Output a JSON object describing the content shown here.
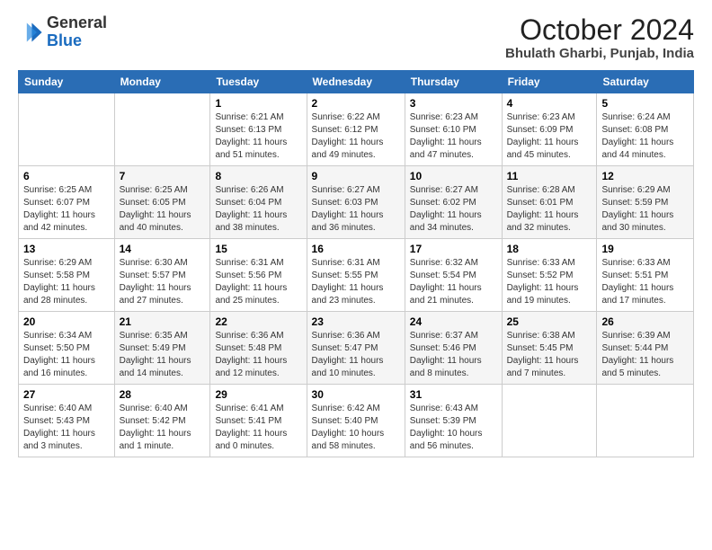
{
  "header": {
    "logo": {
      "general": "General",
      "blue": "Blue"
    },
    "title": "October 2024",
    "subtitle": "Bhulath Gharbi, Punjab, India"
  },
  "weekdays": [
    "Sunday",
    "Monday",
    "Tuesday",
    "Wednesday",
    "Thursday",
    "Friday",
    "Saturday"
  ],
  "weeks": [
    [
      {
        "day": "",
        "info": ""
      },
      {
        "day": "",
        "info": ""
      },
      {
        "day": "1",
        "info": "Sunrise: 6:21 AM\nSunset: 6:13 PM\nDaylight: 11 hours\nand 51 minutes."
      },
      {
        "day": "2",
        "info": "Sunrise: 6:22 AM\nSunset: 6:12 PM\nDaylight: 11 hours\nand 49 minutes."
      },
      {
        "day": "3",
        "info": "Sunrise: 6:23 AM\nSunset: 6:10 PM\nDaylight: 11 hours\nand 47 minutes."
      },
      {
        "day": "4",
        "info": "Sunrise: 6:23 AM\nSunset: 6:09 PM\nDaylight: 11 hours\nand 45 minutes."
      },
      {
        "day": "5",
        "info": "Sunrise: 6:24 AM\nSunset: 6:08 PM\nDaylight: 11 hours\nand 44 minutes."
      }
    ],
    [
      {
        "day": "6",
        "info": "Sunrise: 6:25 AM\nSunset: 6:07 PM\nDaylight: 11 hours\nand 42 minutes."
      },
      {
        "day": "7",
        "info": "Sunrise: 6:25 AM\nSunset: 6:05 PM\nDaylight: 11 hours\nand 40 minutes."
      },
      {
        "day": "8",
        "info": "Sunrise: 6:26 AM\nSunset: 6:04 PM\nDaylight: 11 hours\nand 38 minutes."
      },
      {
        "day": "9",
        "info": "Sunrise: 6:27 AM\nSunset: 6:03 PM\nDaylight: 11 hours\nand 36 minutes."
      },
      {
        "day": "10",
        "info": "Sunrise: 6:27 AM\nSunset: 6:02 PM\nDaylight: 11 hours\nand 34 minutes."
      },
      {
        "day": "11",
        "info": "Sunrise: 6:28 AM\nSunset: 6:01 PM\nDaylight: 11 hours\nand 32 minutes."
      },
      {
        "day": "12",
        "info": "Sunrise: 6:29 AM\nSunset: 5:59 PM\nDaylight: 11 hours\nand 30 minutes."
      }
    ],
    [
      {
        "day": "13",
        "info": "Sunrise: 6:29 AM\nSunset: 5:58 PM\nDaylight: 11 hours\nand 28 minutes."
      },
      {
        "day": "14",
        "info": "Sunrise: 6:30 AM\nSunset: 5:57 PM\nDaylight: 11 hours\nand 27 minutes."
      },
      {
        "day": "15",
        "info": "Sunrise: 6:31 AM\nSunset: 5:56 PM\nDaylight: 11 hours\nand 25 minutes."
      },
      {
        "day": "16",
        "info": "Sunrise: 6:31 AM\nSunset: 5:55 PM\nDaylight: 11 hours\nand 23 minutes."
      },
      {
        "day": "17",
        "info": "Sunrise: 6:32 AM\nSunset: 5:54 PM\nDaylight: 11 hours\nand 21 minutes."
      },
      {
        "day": "18",
        "info": "Sunrise: 6:33 AM\nSunset: 5:52 PM\nDaylight: 11 hours\nand 19 minutes."
      },
      {
        "day": "19",
        "info": "Sunrise: 6:33 AM\nSunset: 5:51 PM\nDaylight: 11 hours\nand 17 minutes."
      }
    ],
    [
      {
        "day": "20",
        "info": "Sunrise: 6:34 AM\nSunset: 5:50 PM\nDaylight: 11 hours\nand 16 minutes."
      },
      {
        "day": "21",
        "info": "Sunrise: 6:35 AM\nSunset: 5:49 PM\nDaylight: 11 hours\nand 14 minutes."
      },
      {
        "day": "22",
        "info": "Sunrise: 6:36 AM\nSunset: 5:48 PM\nDaylight: 11 hours\nand 12 minutes."
      },
      {
        "day": "23",
        "info": "Sunrise: 6:36 AM\nSunset: 5:47 PM\nDaylight: 11 hours\nand 10 minutes."
      },
      {
        "day": "24",
        "info": "Sunrise: 6:37 AM\nSunset: 5:46 PM\nDaylight: 11 hours\nand 8 minutes."
      },
      {
        "day": "25",
        "info": "Sunrise: 6:38 AM\nSunset: 5:45 PM\nDaylight: 11 hours\nand 7 minutes."
      },
      {
        "day": "26",
        "info": "Sunrise: 6:39 AM\nSunset: 5:44 PM\nDaylight: 11 hours\nand 5 minutes."
      }
    ],
    [
      {
        "day": "27",
        "info": "Sunrise: 6:40 AM\nSunset: 5:43 PM\nDaylight: 11 hours\nand 3 minutes."
      },
      {
        "day": "28",
        "info": "Sunrise: 6:40 AM\nSunset: 5:42 PM\nDaylight: 11 hours\nand 1 minute."
      },
      {
        "day": "29",
        "info": "Sunrise: 6:41 AM\nSunset: 5:41 PM\nDaylight: 11 hours\nand 0 minutes."
      },
      {
        "day": "30",
        "info": "Sunrise: 6:42 AM\nSunset: 5:40 PM\nDaylight: 10 hours\nand 58 minutes."
      },
      {
        "day": "31",
        "info": "Sunrise: 6:43 AM\nSunset: 5:39 PM\nDaylight: 10 hours\nand 56 minutes."
      },
      {
        "day": "",
        "info": ""
      },
      {
        "day": "",
        "info": ""
      }
    ]
  ]
}
